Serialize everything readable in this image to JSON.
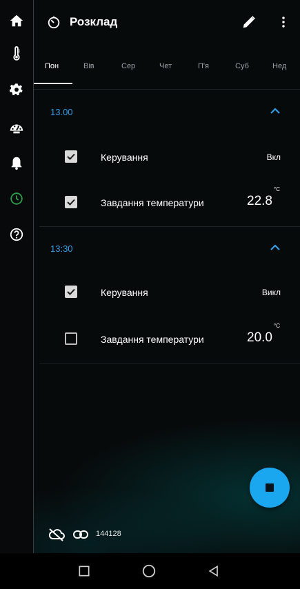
{
  "rail": {
    "items": [
      {
        "icon": "home-icon"
      },
      {
        "icon": "thermometer-icon"
      },
      {
        "icon": "gear-icon"
      },
      {
        "icon": "gauge-icon"
      },
      {
        "icon": "bell-icon"
      },
      {
        "icon": "clock-icon",
        "active": true
      },
      {
        "icon": "help-icon"
      }
    ],
    "active_color": "#2e9d4c"
  },
  "appbar": {
    "title": "Розклад",
    "title_icon": "timer-icon",
    "actions": [
      "edit-icon",
      "more-vert-icon"
    ]
  },
  "tabs": [
    "Пон",
    "Вів",
    "Сер",
    "Чет",
    "П'я",
    "Суб",
    "Нед"
  ],
  "active_tab": 0,
  "schedule": [
    {
      "time": "13.00",
      "rows": [
        {
          "checked": true,
          "label": "Керування",
          "value": "Вкл"
        },
        {
          "checked": true,
          "label": "Завдання температури",
          "value": "22.8",
          "unit": "°C"
        }
      ]
    },
    {
      "time": "13:30",
      "rows": [
        {
          "checked": true,
          "label": "Керування",
          "value": "Викл"
        },
        {
          "checked": false,
          "label": "Завдання температури",
          "value": "20.0",
          "unit": "°C"
        }
      ]
    }
  ],
  "accent_color": "#1aa7f0",
  "status_bar": {
    "cloud_icon": "cloud-off-icon",
    "link_icon": "link-icon",
    "device_id": "144128"
  },
  "system_nav": [
    "recents-square-icon",
    "home-circle-icon",
    "back-triangle-icon"
  ]
}
